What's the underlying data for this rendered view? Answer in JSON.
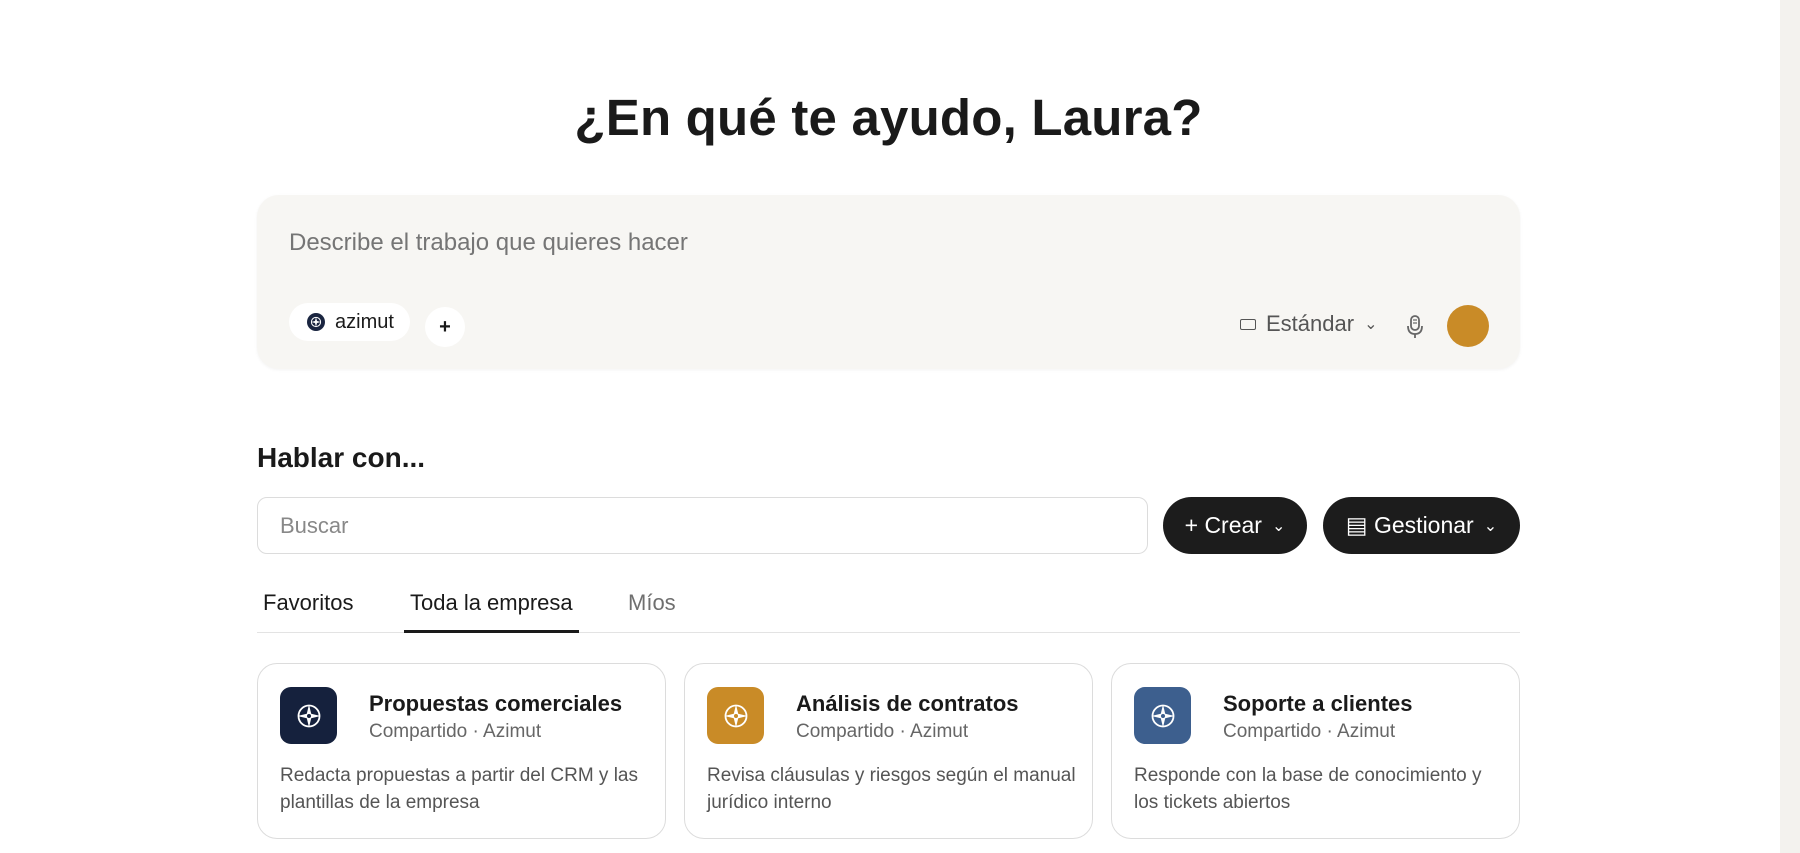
{
  "greeting": "¿En qué te ayudo, Laura?",
  "composer": {
    "placeholder": "Describe el trabajo que quieres hacer",
    "chip_label": "azimut",
    "add_label": "+",
    "mode_label": "Estándar",
    "mode_chevron": "⌄",
    "send_color": "#c98b27"
  },
  "section": {
    "title": "Hablar con..."
  },
  "search": {
    "placeholder": "Buscar"
  },
  "actions": {
    "create_label": "+ Crear",
    "manage_label": "▤ Gestionar",
    "chevron": "⌄"
  },
  "tabs": [
    {
      "label": "Favoritos",
      "active": false
    },
    {
      "label": "Toda la empresa",
      "active": true
    },
    {
      "label": "Míos",
      "active": false
    }
  ],
  "cards": [
    {
      "title": "Propuestas comerciales",
      "subtitle": "Compartido · Azimut",
      "description": "Redacta propuestas a partir del CRM y las plantillas de la empresa",
      "icon": "compass-icon",
      "color": "#15213d"
    },
    {
      "title": "Análisis de contratos",
      "subtitle": "Compartido · Azimut",
      "description": "Revisa cláusulas y riesgos según el manual jurídico interno",
      "icon": "compass-icon",
      "color": "#c98b27"
    },
    {
      "title": "Soporte a clientes",
      "subtitle": "Compartido · Azimut",
      "description": "Responde con la base de conocimiento y los tickets abiertos",
      "icon": "compass-icon",
      "color": "#3d5f8e"
    }
  ]
}
